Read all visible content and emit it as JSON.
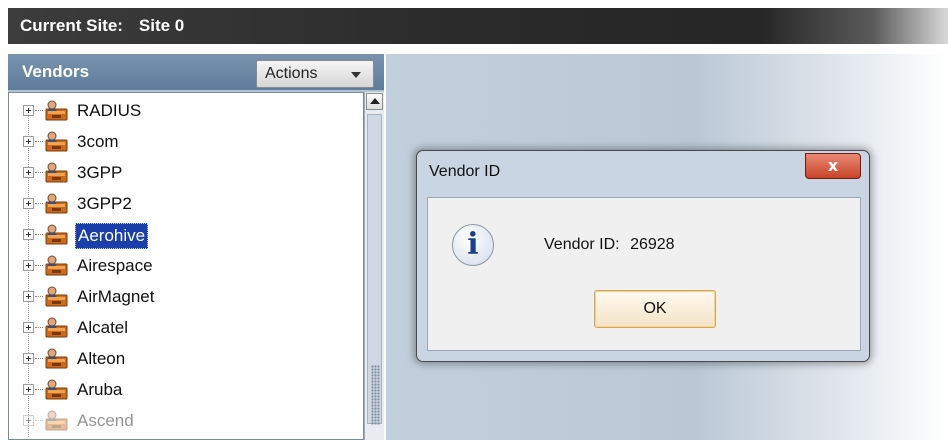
{
  "site_bar": {
    "label": "Current Site:",
    "value": "Site 0"
  },
  "vendors_panel": {
    "title": "Vendors",
    "actions_label": "Actions",
    "items": [
      {
        "label": "RADIUS"
      },
      {
        "label": "3com"
      },
      {
        "label": "3GPP"
      },
      {
        "label": "3GPP2"
      },
      {
        "label": "Aerohive",
        "selected": true
      },
      {
        "label": "Airespace"
      },
      {
        "label": "AirMagnet"
      },
      {
        "label": "Alcatel"
      },
      {
        "label": "Alteon"
      },
      {
        "label": "Aruba"
      },
      {
        "label": "Ascend"
      }
    ]
  },
  "dialog": {
    "title": "Vendor ID",
    "close_label": "x",
    "message_label": "Vendor ID:",
    "message_value": "26928",
    "ok_label": "OK"
  },
  "icons": {
    "vendor": "vendor-icon",
    "info": "info-icon",
    "close": "close-icon",
    "expand": "expand-icon"
  },
  "colors": {
    "selection": "#1a3faa",
    "header": "#5d7b9b",
    "close_button": "#c8432a"
  }
}
